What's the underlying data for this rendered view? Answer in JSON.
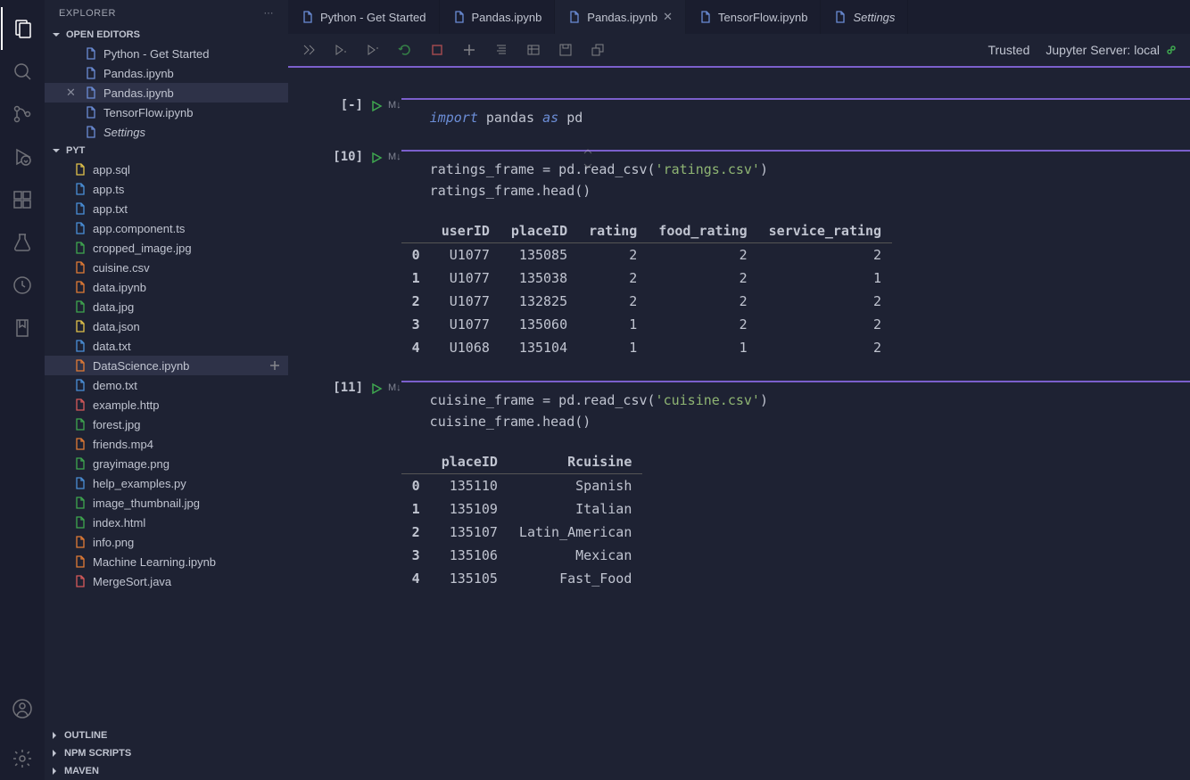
{
  "explorer": {
    "title": "EXPLORER",
    "openEditorsLabel": "OPEN EDITORS",
    "openEditors": [
      {
        "name": "Python - Get Started",
        "icon": "file-blue",
        "active": false
      },
      {
        "name": "Pandas.ipynb",
        "icon": "file-blue",
        "active": false
      },
      {
        "name": "Pandas.ipynb",
        "icon": "file-blue",
        "active": true
      },
      {
        "name": "TensorFlow.ipynb",
        "icon": "file-blue",
        "active": false
      },
      {
        "name": "Settings",
        "icon": "file-blue",
        "active": false,
        "italic": true
      }
    ],
    "workspaceLabel": "PYT",
    "files": [
      {
        "name": "app.sql",
        "iconColor": "#e2c24a"
      },
      {
        "name": "app.ts",
        "iconColor": "#4a90d9"
      },
      {
        "name": "app.txt",
        "iconColor": "#4a90d9"
      },
      {
        "name": "app.component.ts",
        "iconColor": "#4a90d9"
      },
      {
        "name": "cropped_image.jpg",
        "iconColor": "#3fa84f"
      },
      {
        "name": "cuisine.csv",
        "iconColor": "#e27b35"
      },
      {
        "name": "data.ipynb",
        "iconColor": "#e27b35"
      },
      {
        "name": "data.jpg",
        "iconColor": "#3fa84f"
      },
      {
        "name": "data.json",
        "iconColor": "#e2c24a"
      },
      {
        "name": "data.txt",
        "iconColor": "#4a90d9"
      },
      {
        "name": "DataScience.ipynb",
        "iconColor": "#e27b35",
        "active": true
      },
      {
        "name": "demo.txt",
        "iconColor": "#4a90d9"
      },
      {
        "name": "example.http",
        "iconColor": "#d65a5a"
      },
      {
        "name": "forest.jpg",
        "iconColor": "#3fa84f"
      },
      {
        "name": "friends.mp4",
        "iconColor": "#e27b35"
      },
      {
        "name": "grayimage.png",
        "iconColor": "#3fa84f"
      },
      {
        "name": "help_examples.py",
        "iconColor": "#4a8fd6"
      },
      {
        "name": "image_thumbnail.jpg",
        "iconColor": "#3fa84f"
      },
      {
        "name": "index.html",
        "iconColor": "#3fa84f"
      },
      {
        "name": "info.png",
        "iconColor": "#e27b35"
      },
      {
        "name": "Machine Learning.ipynb",
        "iconColor": "#e27b35"
      },
      {
        "name": "MergeSort.java",
        "iconColor": "#d65a5a"
      }
    ],
    "bottomSections": [
      "OUTLINE",
      "NPM SCRIPTS",
      "MAVEN"
    ]
  },
  "tabs": [
    {
      "label": "Python - Get Started"
    },
    {
      "label": "Pandas.ipynb"
    },
    {
      "label": "Pandas.ipynb",
      "active": true,
      "close": true
    },
    {
      "label": "TensorFlow.ipynb"
    },
    {
      "label": "Settings",
      "italic": true
    }
  ],
  "toolbar": {
    "trusted": "Trusted",
    "server": "Jupyter Server: local"
  },
  "cells": [
    {
      "prompt": "[-]",
      "md": "M↓",
      "code": [
        {
          "segments": [
            {
              "t": "import",
              "c": "kw"
            },
            {
              "t": " pandas ",
              "c": ""
            },
            {
              "t": "as",
              "c": "kw"
            },
            {
              "t": " pd",
              "c": ""
            }
          ]
        }
      ]
    },
    {
      "prompt": "[10]",
      "md": "M↓",
      "code": [
        {
          "segments": [
            {
              "t": "ratings_frame = pd.read_csv(",
              "c": ""
            },
            {
              "t": "'ratings.csv'",
              "c": "str"
            },
            {
              "t": ")",
              "c": ""
            }
          ]
        },
        {
          "segments": [
            {
              "t": "ratings_frame.head()",
              "c": ""
            }
          ]
        }
      ],
      "table": {
        "headers": [
          "",
          "userID",
          "placeID",
          "rating",
          "food_rating",
          "service_rating"
        ],
        "rows": [
          [
            "0",
            "U1077",
            "135085",
            "2",
            "2",
            "2"
          ],
          [
            "1",
            "U1077",
            "135038",
            "2",
            "2",
            "1"
          ],
          [
            "2",
            "U1077",
            "132825",
            "2",
            "2",
            "2"
          ],
          [
            "3",
            "U1077",
            "135060",
            "1",
            "2",
            "2"
          ],
          [
            "4",
            "U1068",
            "135104",
            "1",
            "1",
            "2"
          ]
        ]
      }
    },
    {
      "prompt": "[11]",
      "md": "M↓",
      "code": [
        {
          "segments": [
            {
              "t": "cuisine_frame = pd.read_csv(",
              "c": ""
            },
            {
              "t": "'cuisine.csv'",
              "c": "str"
            },
            {
              "t": ")",
              "c": ""
            }
          ]
        },
        {
          "segments": [
            {
              "t": "cuisine_frame.head()",
              "c": ""
            }
          ]
        }
      ],
      "table": {
        "headers": [
          "",
          "placeID",
          "Rcuisine"
        ],
        "rows": [
          [
            "0",
            "135110",
            "Spanish"
          ],
          [
            "1",
            "135109",
            "Italian"
          ],
          [
            "2",
            "135107",
            "Latin_American"
          ],
          [
            "3",
            "135106",
            "Mexican"
          ],
          [
            "4",
            "135105",
            "Fast_Food"
          ]
        ]
      }
    }
  ]
}
